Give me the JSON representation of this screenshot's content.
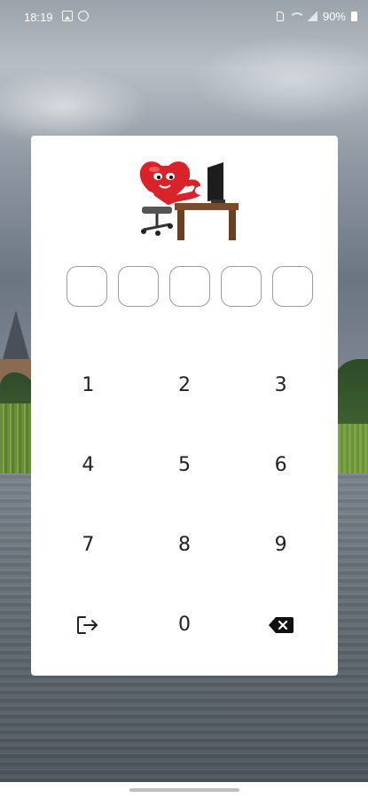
{
  "status_bar": {
    "time": "18:19",
    "battery": "90%",
    "icons": [
      "gallery-icon",
      "sync-icon",
      "sim-icon",
      "wifi-icon",
      "signal-icon",
      "battery-icon"
    ]
  },
  "pin": {
    "length": 5,
    "entered": ""
  },
  "keypad": {
    "keys": [
      {
        "label": "1",
        "name": "key-1"
      },
      {
        "label": "2",
        "name": "key-2"
      },
      {
        "label": "3",
        "name": "key-3"
      },
      {
        "label": "4",
        "name": "key-4"
      },
      {
        "label": "5",
        "name": "key-5"
      },
      {
        "label": "6",
        "name": "key-6"
      },
      {
        "label": "7",
        "name": "key-7"
      },
      {
        "label": "8",
        "name": "key-8"
      },
      {
        "label": "9",
        "name": "key-9"
      },
      {
        "icon": "logout-icon",
        "name": "logout-button"
      },
      {
        "label": "0",
        "name": "key-0"
      },
      {
        "icon": "backspace-icon",
        "name": "backspace-button"
      }
    ]
  },
  "mascot": {
    "icon": "heart-mascot-at-desk-icon"
  },
  "colors": {
    "dialog_bg": "#ffffff",
    "pin_border": "#9a9a9a",
    "key_text": "#222222",
    "mascot_red": "#d9232a"
  }
}
